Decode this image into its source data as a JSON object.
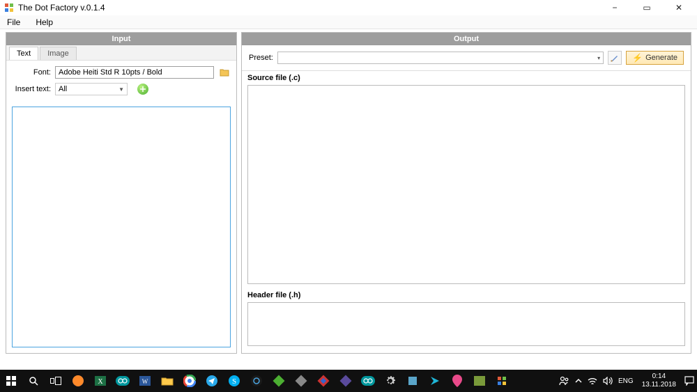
{
  "window": {
    "title": "The Dot Factory v.0.1.4"
  },
  "menubar": {
    "file": "File",
    "help": "Help"
  },
  "input": {
    "header": "Input",
    "tabs": {
      "text": "Text",
      "image": "Image"
    },
    "font_label": "Font:",
    "font_value": "Adobe Heiti Std R 10pts / Bold",
    "insert_label": "Insert text:",
    "insert_value": "All"
  },
  "output": {
    "header": "Output",
    "preset_label": "Preset:",
    "preset_value": "",
    "generate": "Generate",
    "source_label": "Source file (.c)",
    "header_label": "Header file (.h)"
  },
  "taskbar": {
    "lang": "ENG",
    "time": "0:14",
    "date": "13.11.2018"
  }
}
